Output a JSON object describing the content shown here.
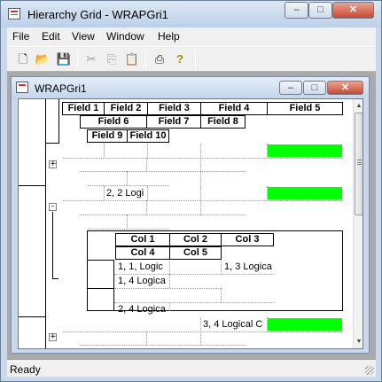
{
  "window": {
    "title": "Hierarchy Grid - WRAPGri1",
    "minimize": "–",
    "maximize": "□",
    "close": "✕"
  },
  "menu": [
    "File",
    "Edit",
    "View",
    "Window",
    "Help"
  ],
  "toolbar": {
    "icons": [
      "new-icon",
      "open-icon",
      "save-icon",
      "cut-icon",
      "copy-icon",
      "paste-icon",
      "print-icon",
      "help-icon"
    ],
    "glyphs": [
      "🗋",
      "📂",
      "💾",
      "✂",
      "⎘",
      "📋",
      "⎙",
      "?"
    ]
  },
  "child": {
    "title": "WRAPGri1",
    "minimize": "–",
    "maximize": "□",
    "close": "✕"
  },
  "grid": {
    "headers": {
      "row1": [
        "Field 1",
        "Field 2",
        "Field 3",
        "Field 4",
        "Field 5"
      ],
      "row2": [
        "Field 6",
        "Field 7",
        "Field 8"
      ],
      "row3": [
        "Field 9",
        "Field 10"
      ]
    },
    "rows": {
      "r2_field2": "2, 2 Logi",
      "r3_field4": "3, 4 Logical C"
    },
    "expanders": [
      "+",
      "–",
      "+"
    ],
    "child_grid": {
      "headers": {
        "row1": [
          "Col 1",
          "Col 2",
          "Col 3"
        ],
        "row2": [
          "Col 4",
          "Col 5"
        ]
      },
      "cells": {
        "r1_col1": "1, 1, Logic",
        "r1_col3": "1, 3 Logica",
        "r1_col4": "1, 4 Logica",
        "r2_col4": "2, 4 Logica"
      }
    },
    "highlight_color": "#00ff00"
  },
  "status": "Ready"
}
